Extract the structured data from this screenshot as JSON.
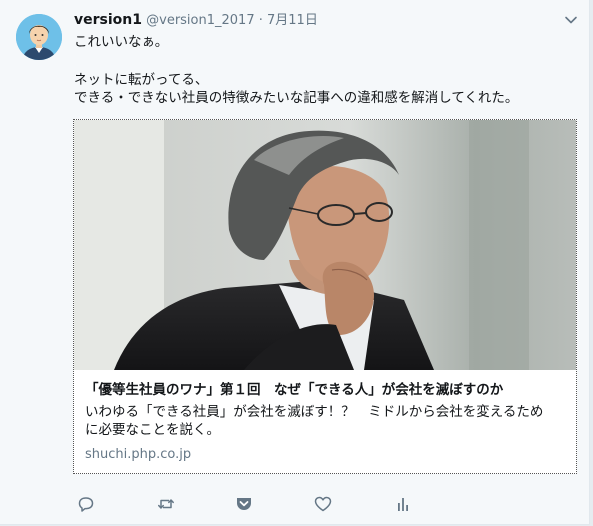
{
  "tweet": {
    "author_name": "version1",
    "author_handle": "@version1_2017",
    "separator": "·",
    "timestamp": "7月11日",
    "lines": [
      "これいいなぁ。",
      "ネットに転がってる、",
      "できる・できない社員の特徴みたいな記事への違和感を解消してくれた。"
    ]
  },
  "card": {
    "title": "「優等生社員のワナ」第１回　なぜ「できる人」が会社を滅ぼすのか",
    "description_lines": [
      "いわゆる「できる社員」が会社を滅ぼす！？　ミドルから会社を変えるため",
      "に必要なことを説く。"
    ],
    "domain": "shuchi.php.co.jp"
  },
  "actions": [
    "reply-icon",
    "retweet-icon",
    "pocket-icon",
    "like-icon",
    "analytics-icon"
  ],
  "colors": {
    "background": "#f5f8fa",
    "text": "#14171a",
    "secondary": "#657786",
    "icon": "#657786",
    "avatar_bg": "#6ec0e8"
  }
}
